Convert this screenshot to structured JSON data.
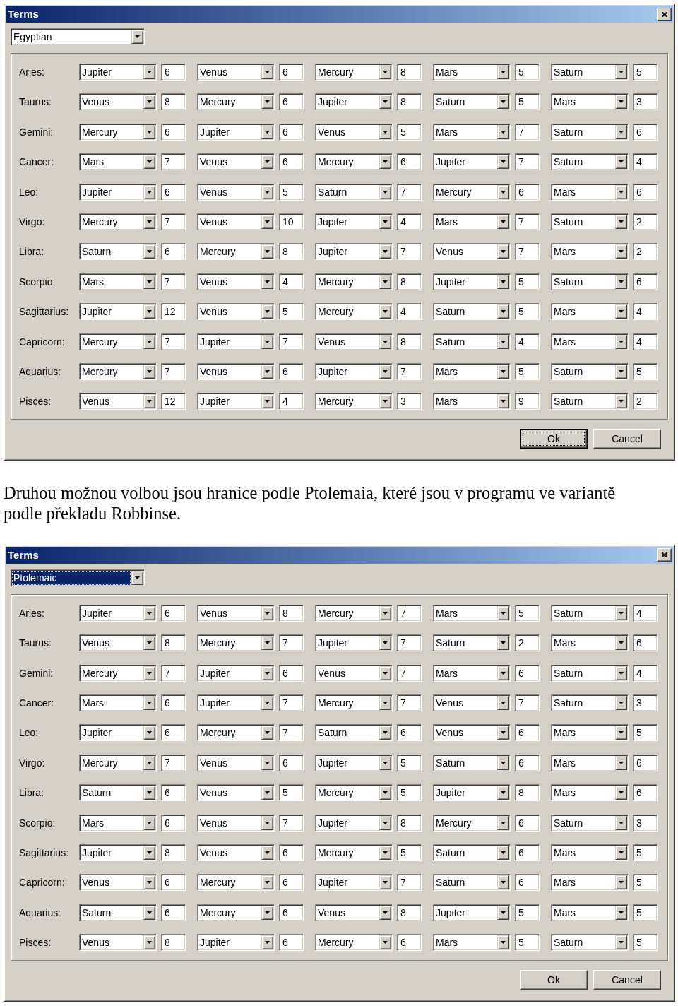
{
  "blocks": [
    {
      "kind": "dialog",
      "title": "Terms",
      "system": {
        "value": "Egyptian",
        "focused": false
      },
      "rows": [
        {
          "sign": "Aries:",
          "terms": [
            {
              "planet": "Jupiter",
              "degrees": "6"
            },
            {
              "planet": "Venus",
              "degrees": "6"
            },
            {
              "planet": "Mercury",
              "degrees": "8"
            },
            {
              "planet": "Mars",
              "degrees": "5"
            },
            {
              "planet": "Saturn",
              "degrees": "5"
            }
          ]
        },
        {
          "sign": "Taurus:",
          "terms": [
            {
              "planet": "Venus",
              "degrees": "8"
            },
            {
              "planet": "Mercury",
              "degrees": "6"
            },
            {
              "planet": "Jupiter",
              "degrees": "8"
            },
            {
              "planet": "Saturn",
              "degrees": "5"
            },
            {
              "planet": "Mars",
              "degrees": "3"
            }
          ]
        },
        {
          "sign": "Gemini:",
          "terms": [
            {
              "planet": "Mercury",
              "degrees": "6"
            },
            {
              "planet": "Jupiter",
              "degrees": "6"
            },
            {
              "planet": "Venus",
              "degrees": "5"
            },
            {
              "planet": "Mars",
              "degrees": "7"
            },
            {
              "planet": "Saturn",
              "degrees": "6"
            }
          ]
        },
        {
          "sign": "Cancer:",
          "terms": [
            {
              "planet": "Mars",
              "degrees": "7"
            },
            {
              "planet": "Venus",
              "degrees": "6"
            },
            {
              "planet": "Mercury",
              "degrees": "6"
            },
            {
              "planet": "Jupiter",
              "degrees": "7"
            },
            {
              "planet": "Saturn",
              "degrees": "4"
            }
          ]
        },
        {
          "sign": "Leo:",
          "terms": [
            {
              "planet": "Jupiter",
              "degrees": "6"
            },
            {
              "planet": "Venus",
              "degrees": "5"
            },
            {
              "planet": "Saturn",
              "degrees": "7"
            },
            {
              "planet": "Mercury",
              "degrees": "6"
            },
            {
              "planet": "Mars",
              "degrees": "6"
            }
          ]
        },
        {
          "sign": "Virgo:",
          "terms": [
            {
              "planet": "Mercury",
              "degrees": "7"
            },
            {
              "planet": "Venus",
              "degrees": "10"
            },
            {
              "planet": "Jupiter",
              "degrees": "4"
            },
            {
              "planet": "Mars",
              "degrees": "7"
            },
            {
              "planet": "Saturn",
              "degrees": "2"
            }
          ]
        },
        {
          "sign": "Libra:",
          "terms": [
            {
              "planet": "Saturn",
              "degrees": "6"
            },
            {
              "planet": "Mercury",
              "degrees": "8"
            },
            {
              "planet": "Jupiter",
              "degrees": "7"
            },
            {
              "planet": "Venus",
              "degrees": "7"
            },
            {
              "planet": "Mars",
              "degrees": "2"
            }
          ]
        },
        {
          "sign": "Scorpio:",
          "terms": [
            {
              "planet": "Mars",
              "degrees": "7"
            },
            {
              "planet": "Venus",
              "degrees": "4"
            },
            {
              "planet": "Mercury",
              "degrees": "8"
            },
            {
              "planet": "Jupiter",
              "degrees": "5"
            },
            {
              "planet": "Saturn",
              "degrees": "6"
            }
          ]
        },
        {
          "sign": "Sagittarius:",
          "terms": [
            {
              "planet": "Jupiter",
              "degrees": "12"
            },
            {
              "planet": "Venus",
              "degrees": "5"
            },
            {
              "planet": "Mercury",
              "degrees": "4"
            },
            {
              "planet": "Saturn",
              "degrees": "5"
            },
            {
              "planet": "Mars",
              "degrees": "4"
            }
          ]
        },
        {
          "sign": "Capricorn:",
          "terms": [
            {
              "planet": "Mercury",
              "degrees": "7"
            },
            {
              "planet": "Jupiter",
              "degrees": "7"
            },
            {
              "planet": "Venus",
              "degrees": "8"
            },
            {
              "planet": "Saturn",
              "degrees": "4"
            },
            {
              "planet": "Mars",
              "degrees": "4"
            }
          ]
        },
        {
          "sign": "Aquarius:",
          "terms": [
            {
              "planet": "Mercury",
              "degrees": "7"
            },
            {
              "planet": "Venus",
              "degrees": "6"
            },
            {
              "planet": "Jupiter",
              "degrees": "7"
            },
            {
              "planet": "Mars",
              "degrees": "5"
            },
            {
              "planet": "Saturn",
              "degrees": "5"
            }
          ]
        },
        {
          "sign": "Pisces:",
          "terms": [
            {
              "planet": "Venus",
              "degrees": "12"
            },
            {
              "planet": "Jupiter",
              "degrees": "4"
            },
            {
              "planet": "Mercury",
              "degrees": "3"
            },
            {
              "planet": "Mars",
              "degrees": "9"
            },
            {
              "planet": "Saturn",
              "degrees": "2"
            }
          ]
        }
      ],
      "buttons": [
        {
          "label": "Ok",
          "focused": true
        },
        {
          "label": "Cancel",
          "focused": false
        }
      ]
    },
    {
      "kind": "paragraph",
      "text": "Druhou možnou volbou jsou hranice podle Ptolemaia, které jsou v programu ve variantě podle překladu Robbinse."
    },
    {
      "kind": "dialog",
      "title": "Terms",
      "system": {
        "value": "Ptolemaic",
        "focused": true
      },
      "rows": [
        {
          "sign": "Aries:",
          "terms": [
            {
              "planet": "Jupiter",
              "degrees": "6"
            },
            {
              "planet": "Venus",
              "degrees": "8"
            },
            {
              "planet": "Mercury",
              "degrees": "7"
            },
            {
              "planet": "Mars",
              "degrees": "5"
            },
            {
              "planet": "Saturn",
              "degrees": "4"
            }
          ]
        },
        {
          "sign": "Taurus:",
          "terms": [
            {
              "planet": "Venus",
              "degrees": "8"
            },
            {
              "planet": "Mercury",
              "degrees": "7"
            },
            {
              "planet": "Jupiter",
              "degrees": "7"
            },
            {
              "planet": "Saturn",
              "degrees": "2"
            },
            {
              "planet": "Mars",
              "degrees": "6"
            }
          ]
        },
        {
          "sign": "Gemini:",
          "terms": [
            {
              "planet": "Mercury",
              "degrees": "7"
            },
            {
              "planet": "Jupiter",
              "degrees": "6"
            },
            {
              "planet": "Venus",
              "degrees": "7"
            },
            {
              "planet": "Mars",
              "degrees": "6"
            },
            {
              "planet": "Saturn",
              "degrees": "4"
            }
          ]
        },
        {
          "sign": "Cancer:",
          "terms": [
            {
              "planet": "Mars",
              "degrees": "6"
            },
            {
              "planet": "Jupiter",
              "degrees": "7"
            },
            {
              "planet": "Mercury",
              "degrees": "7"
            },
            {
              "planet": "Venus",
              "degrees": "7"
            },
            {
              "planet": "Saturn",
              "degrees": "3"
            }
          ]
        },
        {
          "sign": "Leo:",
          "terms": [
            {
              "planet": "Jupiter",
              "degrees": "6"
            },
            {
              "planet": "Mercury",
              "degrees": "7"
            },
            {
              "planet": "Saturn",
              "degrees": "6"
            },
            {
              "planet": "Venus",
              "degrees": "6"
            },
            {
              "planet": "Mars",
              "degrees": "5"
            }
          ]
        },
        {
          "sign": "Virgo:",
          "terms": [
            {
              "planet": "Mercury",
              "degrees": "7"
            },
            {
              "planet": "Venus",
              "degrees": "6"
            },
            {
              "planet": "Jupiter",
              "degrees": "5"
            },
            {
              "planet": "Saturn",
              "degrees": "6"
            },
            {
              "planet": "Mars",
              "degrees": "6"
            }
          ]
        },
        {
          "sign": "Libra:",
          "terms": [
            {
              "planet": "Saturn",
              "degrees": "6"
            },
            {
              "planet": "Venus",
              "degrees": "5"
            },
            {
              "planet": "Mercury",
              "degrees": "5"
            },
            {
              "planet": "Jupiter",
              "degrees": "8"
            },
            {
              "planet": "Mars",
              "degrees": "6"
            }
          ]
        },
        {
          "sign": "Scorpio:",
          "terms": [
            {
              "planet": "Mars",
              "degrees": "6"
            },
            {
              "planet": "Venus",
              "degrees": "7"
            },
            {
              "planet": "Jupiter",
              "degrees": "8"
            },
            {
              "planet": "Mercury",
              "degrees": "6"
            },
            {
              "planet": "Saturn",
              "degrees": "3"
            }
          ]
        },
        {
          "sign": "Sagittarius:",
          "terms": [
            {
              "planet": "Jupiter",
              "degrees": "8"
            },
            {
              "planet": "Venus",
              "degrees": "6"
            },
            {
              "planet": "Mercury",
              "degrees": "5"
            },
            {
              "planet": "Saturn",
              "degrees": "6"
            },
            {
              "planet": "Mars",
              "degrees": "5"
            }
          ]
        },
        {
          "sign": "Capricorn:",
          "terms": [
            {
              "planet": "Venus",
              "degrees": "6"
            },
            {
              "planet": "Mercury",
              "degrees": "6"
            },
            {
              "planet": "Jupiter",
              "degrees": "7"
            },
            {
              "planet": "Saturn",
              "degrees": "6"
            },
            {
              "planet": "Mars",
              "degrees": "5"
            }
          ]
        },
        {
          "sign": "Aquarius:",
          "terms": [
            {
              "planet": "Saturn",
              "degrees": "6"
            },
            {
              "planet": "Mercury",
              "degrees": "6"
            },
            {
              "planet": "Venus",
              "degrees": "8"
            },
            {
              "planet": "Jupiter",
              "degrees": "5"
            },
            {
              "planet": "Mars",
              "degrees": "5"
            }
          ]
        },
        {
          "sign": "Pisces:",
          "terms": [
            {
              "planet": "Venus",
              "degrees": "8"
            },
            {
              "planet": "Jupiter",
              "degrees": "6"
            },
            {
              "planet": "Mercury",
              "degrees": "6"
            },
            {
              "planet": "Mars",
              "degrees": "5"
            },
            {
              "planet": "Saturn",
              "degrees": "5"
            }
          ]
        }
      ],
      "buttons": [
        {
          "label": "Ok",
          "focused": false
        },
        {
          "label": "Cancel",
          "focused": false
        }
      ]
    }
  ]
}
